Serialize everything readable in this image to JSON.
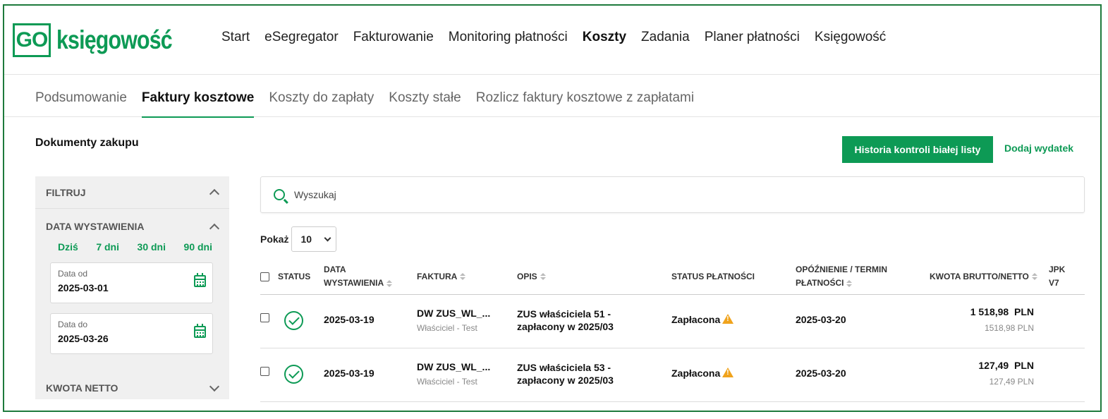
{
  "brand": {
    "logo_box": "GO",
    "logo_text": "księgowość",
    "accent": "#0d9a55"
  },
  "main_nav": [
    "Start",
    "eSegregator",
    "Fakturowanie",
    "Monitoring płatności",
    "Koszty",
    "Zadania",
    "Planer płatności",
    "Księgowość"
  ],
  "main_nav_active": "Koszty",
  "sub_nav": [
    "Podsumowanie",
    "Faktury kosztowe",
    "Koszty do zapłaty",
    "Koszty stałe",
    "Rozlicz faktury kosztowe z zapłatami"
  ],
  "sub_nav_active": "Faktury kosztowe",
  "page": {
    "title": "Dokumenty zakupu",
    "history_button": "Historia kontroli białej listy",
    "add_expense": "Dodaj wydatek"
  },
  "filter": {
    "header": "FILTRUJ",
    "date_section": "DATA WYSTAWIENIA",
    "quick": [
      "Dziś",
      "7 dni",
      "30 dni",
      "90 dni"
    ],
    "date_from_label": "Data od",
    "date_from": "2025-03-01",
    "date_to_label": "Data do",
    "date_to": "2025-03-26",
    "amount_section": "KWOTA NETTO"
  },
  "search": {
    "placeholder": "Wyszukaj"
  },
  "show": {
    "label": "Pokaż",
    "value": "10"
  },
  "table": {
    "headers": {
      "status": "STATUS",
      "date_1": "DATA",
      "date_2": "WYSTAWIENIA",
      "invoice": "FAKTURA",
      "desc": "OPIS",
      "pay_status": "STATUS PŁATNOŚCI",
      "due_1": "OPÓŹNIENIE / TERMIN",
      "due_2": "PŁATNOŚCI",
      "amount": "KWOTA BRUTTO/NETTO",
      "jpk_1": "JPK",
      "jpk_2": "V7"
    },
    "rows": [
      {
        "date": "2025-03-19",
        "invoice": "DW ZUS_WL_...",
        "invoice_sub": "Właściciel - Test",
        "desc_1": "ZUS właściciela 51 -",
        "desc_2": "zapłacony w 2025/03",
        "pay_status": "Zapłacona",
        "due": "2025-03-20",
        "gross": "1 518,98  PLN",
        "net": "1518,98 PLN"
      },
      {
        "date": "2025-03-19",
        "invoice": "DW ZUS_WL_...",
        "invoice_sub": "Właściciel - Test",
        "desc_1": "ZUS właściciela 53 -",
        "desc_2": "zapłacony w 2025/03",
        "pay_status": "Zapłacona",
        "due": "2025-03-20",
        "gross": "127,49  PLN",
        "net": "127,49 PLN"
      }
    ]
  }
}
